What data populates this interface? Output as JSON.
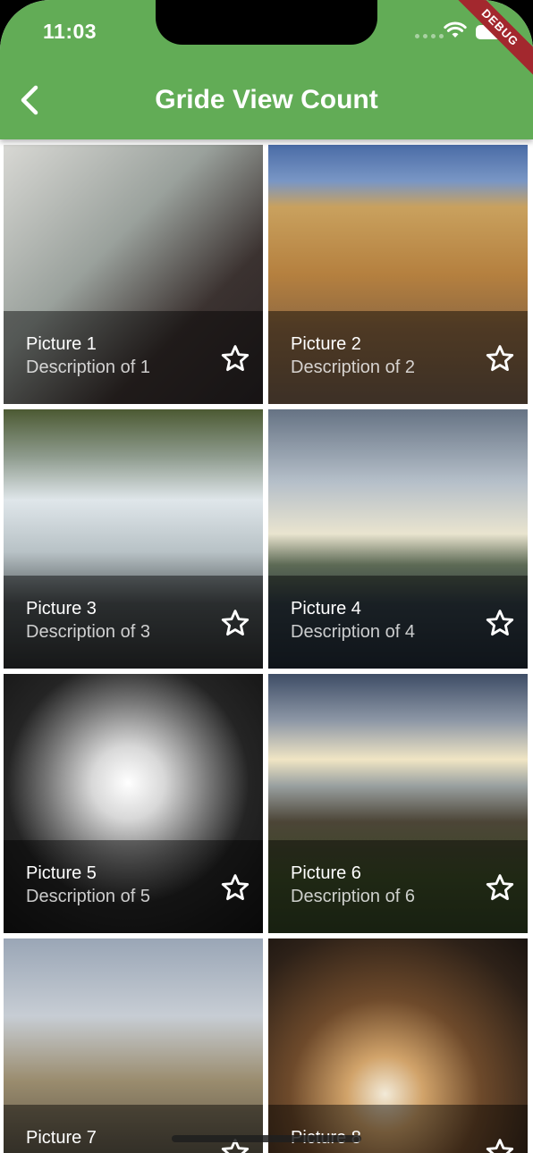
{
  "status_bar": {
    "time": "11:03",
    "debug_label": "DEBUG"
  },
  "app_bar": {
    "title": "Gride View Count",
    "back_icon": "chevron-left-icon"
  },
  "colors": {
    "app_bar": "#62ac56",
    "debug_ribbon": "#a3282e"
  },
  "tiles": [
    {
      "title": "Picture 1",
      "description": "Description of 1",
      "icon": "star-outline-icon"
    },
    {
      "title": "Picture 2",
      "description": "Description of 2",
      "icon": "star-outline-icon"
    },
    {
      "title": "Picture 3",
      "description": "Description of 3",
      "icon": "star-outline-icon"
    },
    {
      "title": "Picture 4",
      "description": "Description of 4",
      "icon": "star-outline-icon"
    },
    {
      "title": "Picture 5",
      "description": "Description of 5",
      "icon": "star-outline-icon"
    },
    {
      "title": "Picture 6",
      "description": "Description of 6",
      "icon": "star-outline-icon"
    },
    {
      "title": "Picture 7",
      "description": "",
      "icon": "star-outline-icon"
    },
    {
      "title": "Picture 8",
      "description": "",
      "icon": "star-outline-icon"
    }
  ]
}
